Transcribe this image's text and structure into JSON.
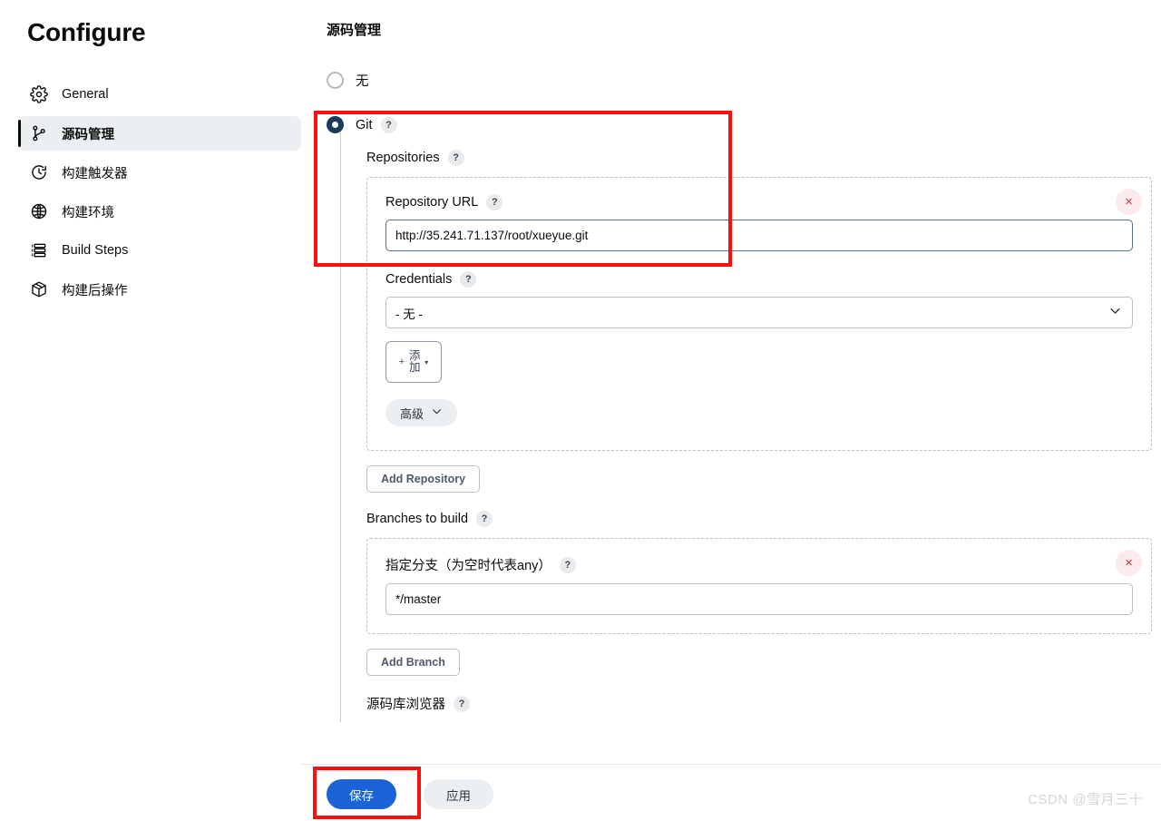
{
  "sidebar": {
    "title": "Configure",
    "items": [
      {
        "label": "General",
        "icon": "gear-icon",
        "active": false
      },
      {
        "label": "源码管理",
        "icon": "git-branch-icon",
        "active": true
      },
      {
        "label": "构建触发器",
        "icon": "clock-icon",
        "active": false
      },
      {
        "label": "构建环境",
        "icon": "globe-icon",
        "active": false
      },
      {
        "label": "Build Steps",
        "icon": "list-icon",
        "active": false
      },
      {
        "label": "构建后操作",
        "icon": "package-icon",
        "active": false
      }
    ]
  },
  "main": {
    "section_title": "源码管理",
    "scm_options": [
      {
        "label": "无",
        "selected": false
      },
      {
        "label": "Git",
        "selected": true,
        "help": "?"
      }
    ],
    "repositories": {
      "label": "Repositories",
      "help": "?",
      "repo_url": {
        "label": "Repository URL",
        "help": "?",
        "value": "http://35.241.71.137/root/xueyue.git",
        "placeholder": ""
      },
      "credentials": {
        "label": "Credentials",
        "help": "?",
        "selected": "- 无 -",
        "options": [
          "- 无 -"
        ],
        "add_button": {
          "plus": "+",
          "label": "添加",
          "caret": "▾"
        }
      },
      "advanced_button": {
        "label": "高级",
        "caret": "⌄"
      },
      "delete_title": "×"
    },
    "add_repository_button": "Add Repository",
    "branches": {
      "label": "Branches to build",
      "help": "?",
      "branch_spec": {
        "label": "指定分支（为空时代表any）",
        "help": "?",
        "value": "*/master",
        "placeholder": ""
      },
      "delete_title": "×"
    },
    "add_branch_button": "Add Branch",
    "repo_browser": {
      "label": "源码库浏览器",
      "help": "?"
    }
  },
  "bottom_bar": {
    "save_label": "保存",
    "apply_label": "应用"
  },
  "watermark": "CSDN @雪月三十",
  "colors": {
    "accent_blue": "#1b63d6",
    "radio_selected": "#1b3a5c",
    "annotation_red": "#fb0f0f",
    "delete_red": "#d4344a"
  }
}
